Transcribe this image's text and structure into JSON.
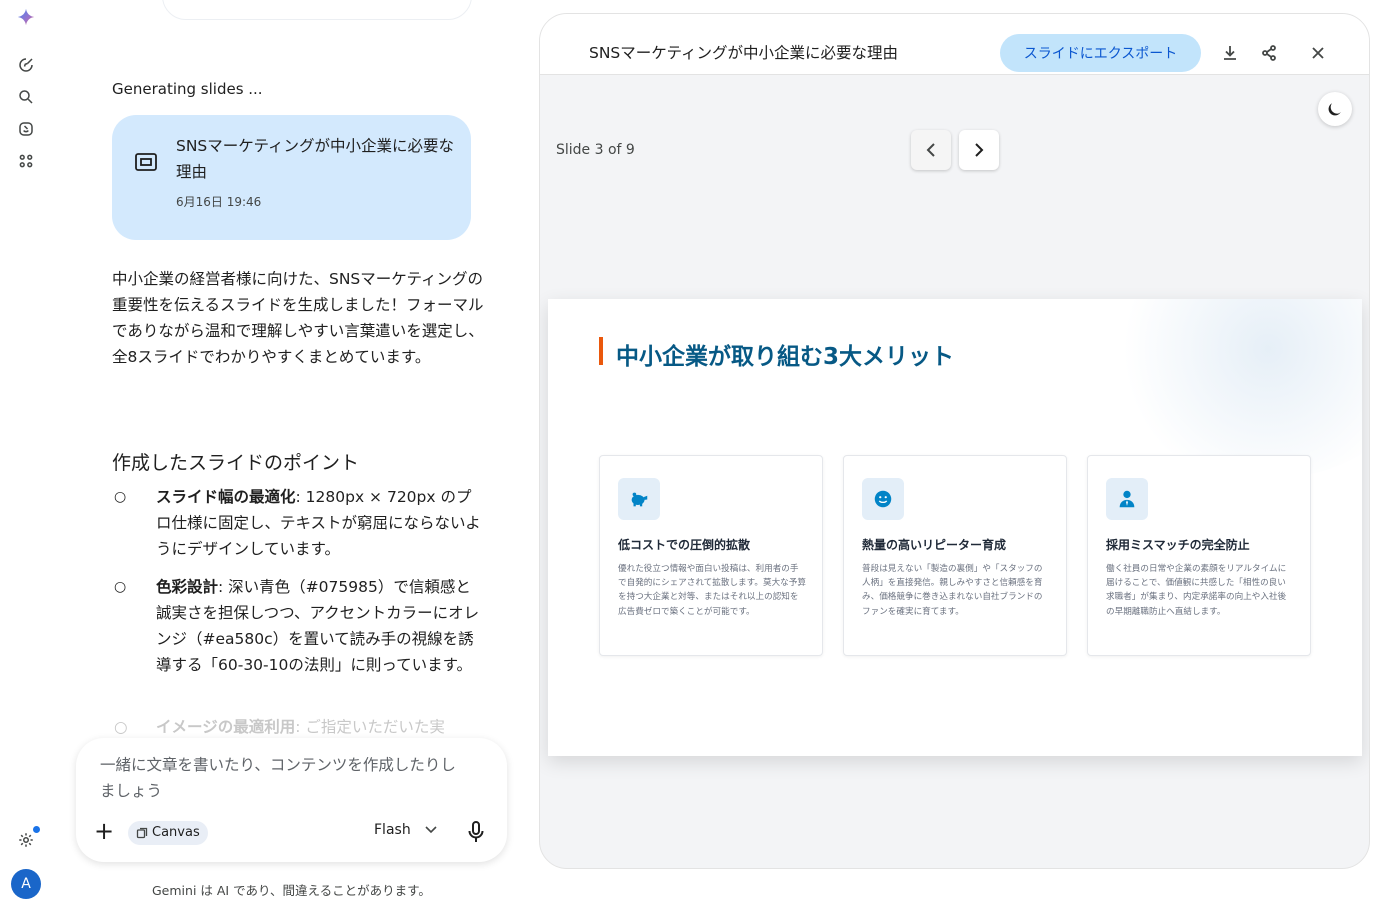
{
  "rail": {
    "avatar_letter": "A"
  },
  "chat": {
    "generating_label": "Generating slides ...",
    "doc_card": {
      "title": "SNSマーケティングが中小企業に必要な理由",
      "date": "6月16日 19:46"
    },
    "intro": "中小企業の経営者様に向けた、SNSマーケティングの重要性を伝えるスライドを生成しました！フォーマルでありながら温和で理解しやすい言葉遣いを選定し、全8スライドでわかりやすくまとめています。",
    "points_heading": "作成したスライドのポイント",
    "bullet_mark": "○",
    "points": [
      {
        "label": "スライド幅の最適化",
        "text": ": 1280px × 720px のプロ仕様に固定し、テキストが窮屈にならないようにデザインしています。"
      },
      {
        "label": "色彩設計",
        "text": ": 深い青色（#075985）で信頼感と誠実さを担保しつつ、アクセントカラーにオレンジ（#ea580c）を置いて読み手の視線を誘導する「60-30-10の法則」に則っています。"
      },
      {
        "label": "イメージの最適利用",
        "text": ": ご指定いただいた実"
      }
    ]
  },
  "input": {
    "placeholder": "一緒に文章を書いたり、コンテンツを作成したりしましょう",
    "canvas_chip": "Canvas",
    "model": "Flash"
  },
  "disclaimer": "Gemini は AI であり、間違えることがあります。",
  "panel": {
    "title": "SNSマーケティングが中小企業に必要な理由",
    "export_button": "スライドにエクスポート",
    "slide_counter": "Slide 3 of 9"
  },
  "slide": {
    "title": "中小企業が取り組む3大メリット",
    "accent_color": "#ea580c",
    "primary_color": "#075985",
    "cards": [
      {
        "icon": "piggy-bank-icon",
        "title": "低コストでの圧倒的拡散",
        "text": "優れた役立つ情報や面白い投稿は、利用者の手で自発的にシェアされて拡散します。莫大な予算を持つ大企業と対等、またはそれ以上の認知を広告費ゼロで築くことが可能です。"
      },
      {
        "icon": "smile-icon",
        "title": "熱量の高いリピーター育成",
        "text": "普段は見えない「製造の裏側」や「スタッフの人柄」を直接発信。親しみやすさと信頼感を育み、価格競争に巻き込まれない自社ブランドのファンを確実に育てます。"
      },
      {
        "icon": "person-icon",
        "title": "採用ミスマッチの完全防止",
        "text": "働く社員の日常や企業の素顔をリアルタイムに届けることで、価値観に共感した「相性の良い求職者」が集まり、内定承諾率の向上や入社後の早期離職防止へ直結します。"
      }
    ]
  }
}
